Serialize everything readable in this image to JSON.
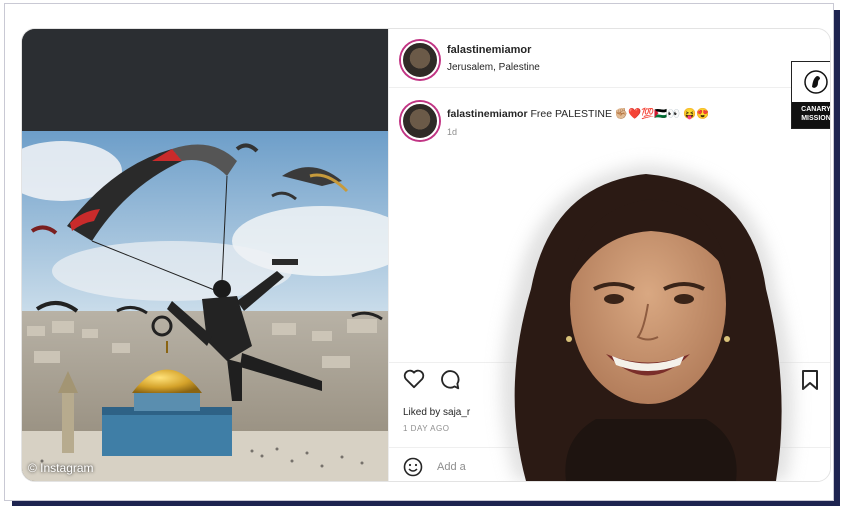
{
  "post": {
    "username": "falastinemiamor",
    "location": "Jerusalem, Palestine",
    "caption_text": "Free PALESTINE",
    "caption_emojis": "✊🏼❤️💯🇵🇸👀 😝😍",
    "time": "1d",
    "liked_by": "Liked by saja_r",
    "ago": "1 DAY AGO",
    "add_comment": "Add a"
  },
  "image": {
    "watermark": "© Instagram"
  },
  "logo": {
    "line1": "CANARY",
    "line2": "MISSION"
  },
  "icons": [
    "heart-icon",
    "comment-icon",
    "bookmark-icon",
    "emoji-icon",
    "canary-bird-icon"
  ],
  "colors": {
    "frame": "#1e2450",
    "avatar_ring": "#c13584",
    "topbar": "#2b2e32"
  }
}
